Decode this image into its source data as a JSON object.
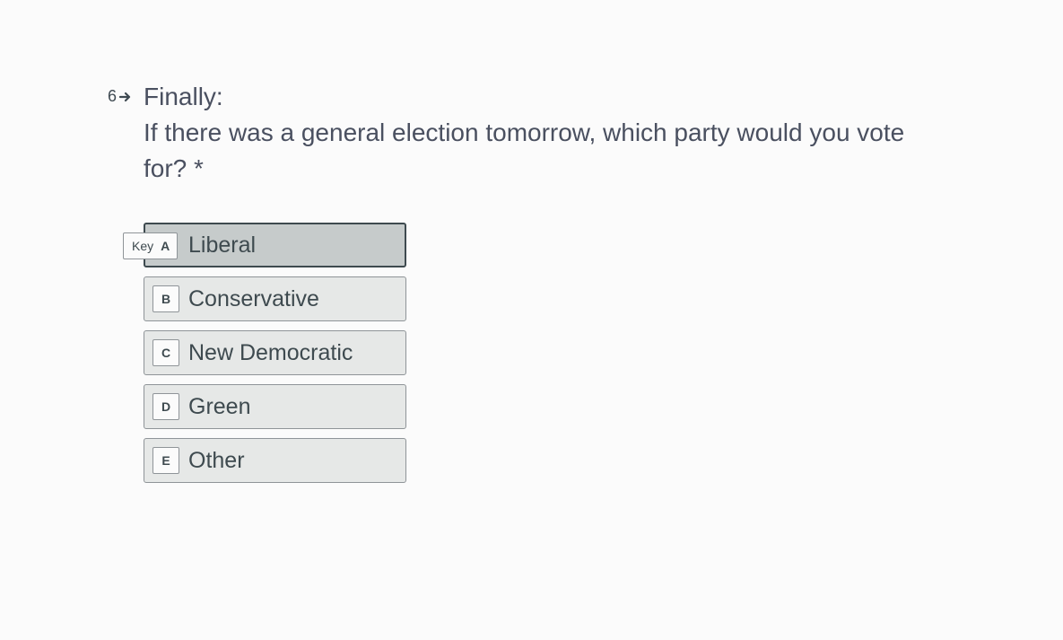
{
  "question": {
    "number": "6",
    "title": "Finally:",
    "text": "If there was a general election tomorrow, which party would you vote for? *",
    "arrow_icon": "arrow-right-icon"
  },
  "key_hint": {
    "label": "Key",
    "letter": "A"
  },
  "choices": [
    {
      "key": "A",
      "label": "Liberal",
      "selected": true
    },
    {
      "key": "B",
      "label": "Conservative",
      "selected": false
    },
    {
      "key": "C",
      "label": "New Democratic",
      "selected": false
    },
    {
      "key": "D",
      "label": "Green",
      "selected": false
    },
    {
      "key": "E",
      "label": "Other",
      "selected": false
    }
  ],
  "colors": {
    "background": "#fbfbfb",
    "question_text": "#4a5060",
    "choice_bg": "#e6e8e7",
    "choice_selected_bg": "#c6cbcb",
    "choice_border": "#8f9498",
    "choice_selected_border": "#3e4a4f"
  }
}
